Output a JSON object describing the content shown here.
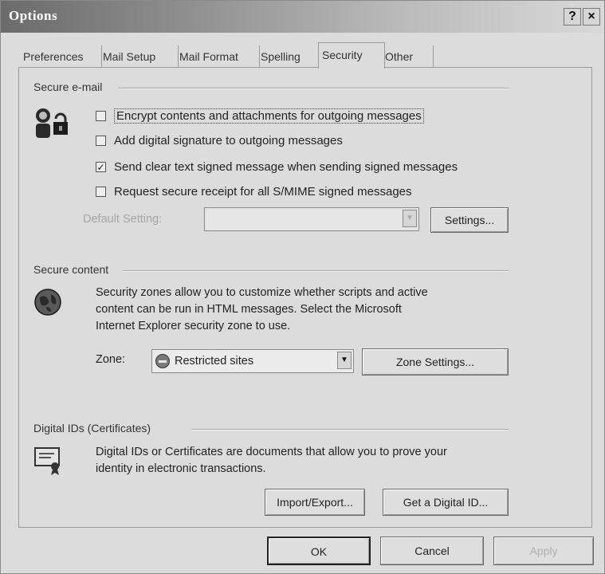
{
  "window": {
    "title": "Options",
    "help_button": "?",
    "close_button": "×"
  },
  "tabs": [
    {
      "label": "Preferences"
    },
    {
      "label": "Mail Setup"
    },
    {
      "label": "Mail Format"
    },
    {
      "label": "Spelling"
    },
    {
      "label": "Security",
      "active": true
    },
    {
      "label": "Other"
    }
  ],
  "secure_email": {
    "title": "Secure e-mail",
    "options": [
      {
        "label": "Encrypt contents and attachments for outgoing messages",
        "checked": false,
        "mark": ""
      },
      {
        "label": "Add digital signature to outgoing messages",
        "checked": false,
        "mark": ""
      },
      {
        "label": "Send clear text signed message when sending signed messages",
        "checked": true,
        "mark": "✓"
      },
      {
        "label": "Request secure receipt for all S/MIME signed messages",
        "checked": false,
        "mark": ""
      }
    ],
    "default_setting_label": "Default Setting:",
    "default_setting_value": "",
    "settings_button": "Settings..."
  },
  "secure_content": {
    "title": "Secure content",
    "description_lines": [
      "Security zones allow you to customize whether scripts and active",
      "content can be run in HTML messages.  Select the Microsoft",
      "Internet Explorer security zone to use."
    ],
    "zone_label": "Zone:",
    "zone_value": "Restricted sites",
    "zone_settings_button": "Zone Settings..."
  },
  "digital_ids": {
    "title": "Digital IDs (Certificates)",
    "description_lines": [
      "Digital IDs or Certificates are documents that allow you to prove your",
      "identity in electronic transactions."
    ],
    "import_export_button": "Import/Export...",
    "get_digital_id_button": "Get a Digital ID..."
  },
  "footer": {
    "ok_button": "OK",
    "cancel_button": "Cancel",
    "apply_button": "Apply"
  },
  "colors": {
    "dialog_bg": "#dcdcdc",
    "titlebar_start": "#6b6b6b",
    "titlebar_end": "#d9d9d9",
    "disabled_text": "#a5a5a5"
  }
}
